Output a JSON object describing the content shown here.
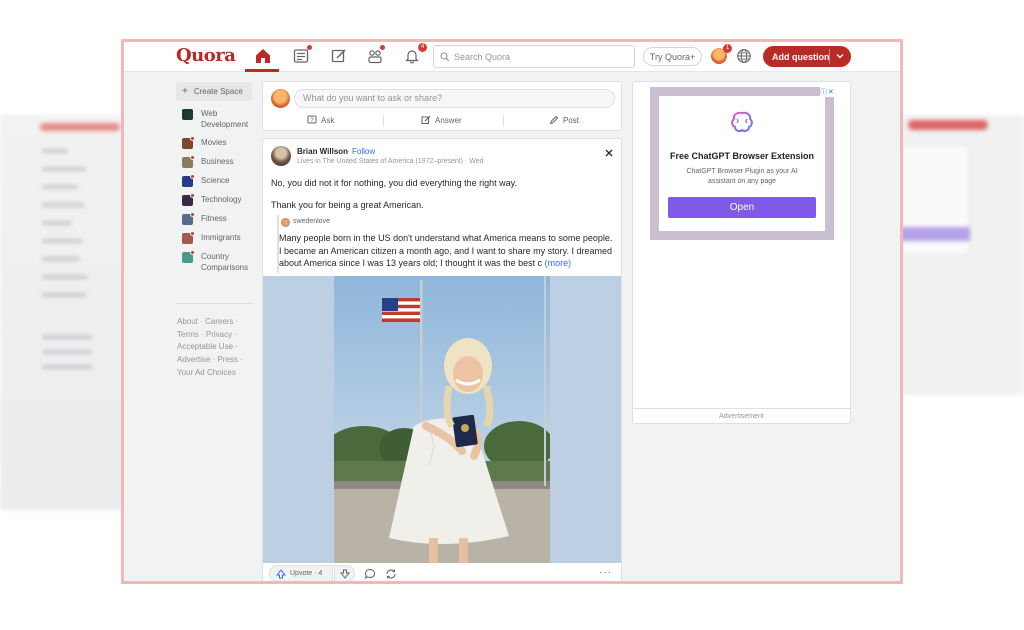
{
  "header": {
    "logo": "Quora",
    "search_placeholder": "Search Quora",
    "try_label": "Try Quora+",
    "add_question_label": "Add question",
    "notification_count": "4",
    "avatar_badge": "1"
  },
  "sidebar": {
    "create_space": "Create Space",
    "items": [
      {
        "label": "Web Development",
        "icon": "web-dev-space-icon",
        "color": "#1d3b2a"
      },
      {
        "label": "Movies",
        "icon": "movies-space-icon",
        "color": "#7a4a2a"
      },
      {
        "label": "Business",
        "icon": "business-space-icon",
        "color": "#8a7a5a"
      },
      {
        "label": "Science",
        "icon": "science-space-icon",
        "color": "#2a3a8a"
      },
      {
        "label": "Technology",
        "icon": "technology-space-icon",
        "color": "#3a2a4a"
      },
      {
        "label": "Fitness",
        "icon": "fitness-space-icon",
        "color": "#5a6a8a"
      },
      {
        "label": "Immigrants",
        "icon": "immigrants-space-icon",
        "color": "#a05a4a"
      },
      {
        "label": "Country Comparisons",
        "icon": "country-comparisons-space-icon",
        "color": "#4a9a8a"
      }
    ],
    "footer_lines": [
      "About · Careers ·",
      "Terms · Privacy ·",
      "Acceptable Use ·",
      "Advertise · Press ·",
      "Your Ad Choices"
    ]
  },
  "composer": {
    "placeholder": "What do you want to ask or share?",
    "ask": "Ask",
    "answer": "Answer",
    "post": "Post"
  },
  "post": {
    "author": "Brian Willson",
    "separator": "·",
    "follow": "Follow",
    "credential": "Lives in The United States of America (1972–present) · Wed",
    "line1": "No, you did not it for nothing, you did everything the right way.",
    "line2": "Thank you for being a great American.",
    "quote_user": "swedenlove",
    "quote_text": "Many people born in the US don't understand what America means to some people. I became an American citizen a month ago, and I want to share my story. I dreamed about America since I was 13 years old; I thought it was the best c",
    "quote_more": "(more)",
    "upvote": "Upvote · 4",
    "more": "···"
  },
  "ad": {
    "title": "Free ChatGPT Browser Extension",
    "subtitle": "ChatGPT Browser Plugin as your AI assistant on any page",
    "button": "Open",
    "label": "Advertisement",
    "info": "ⓘ",
    "close": "✕"
  },
  "colors": {
    "brand": "#b92b27",
    "link": "#2e69ff",
    "ad_button": "#8059e8"
  }
}
